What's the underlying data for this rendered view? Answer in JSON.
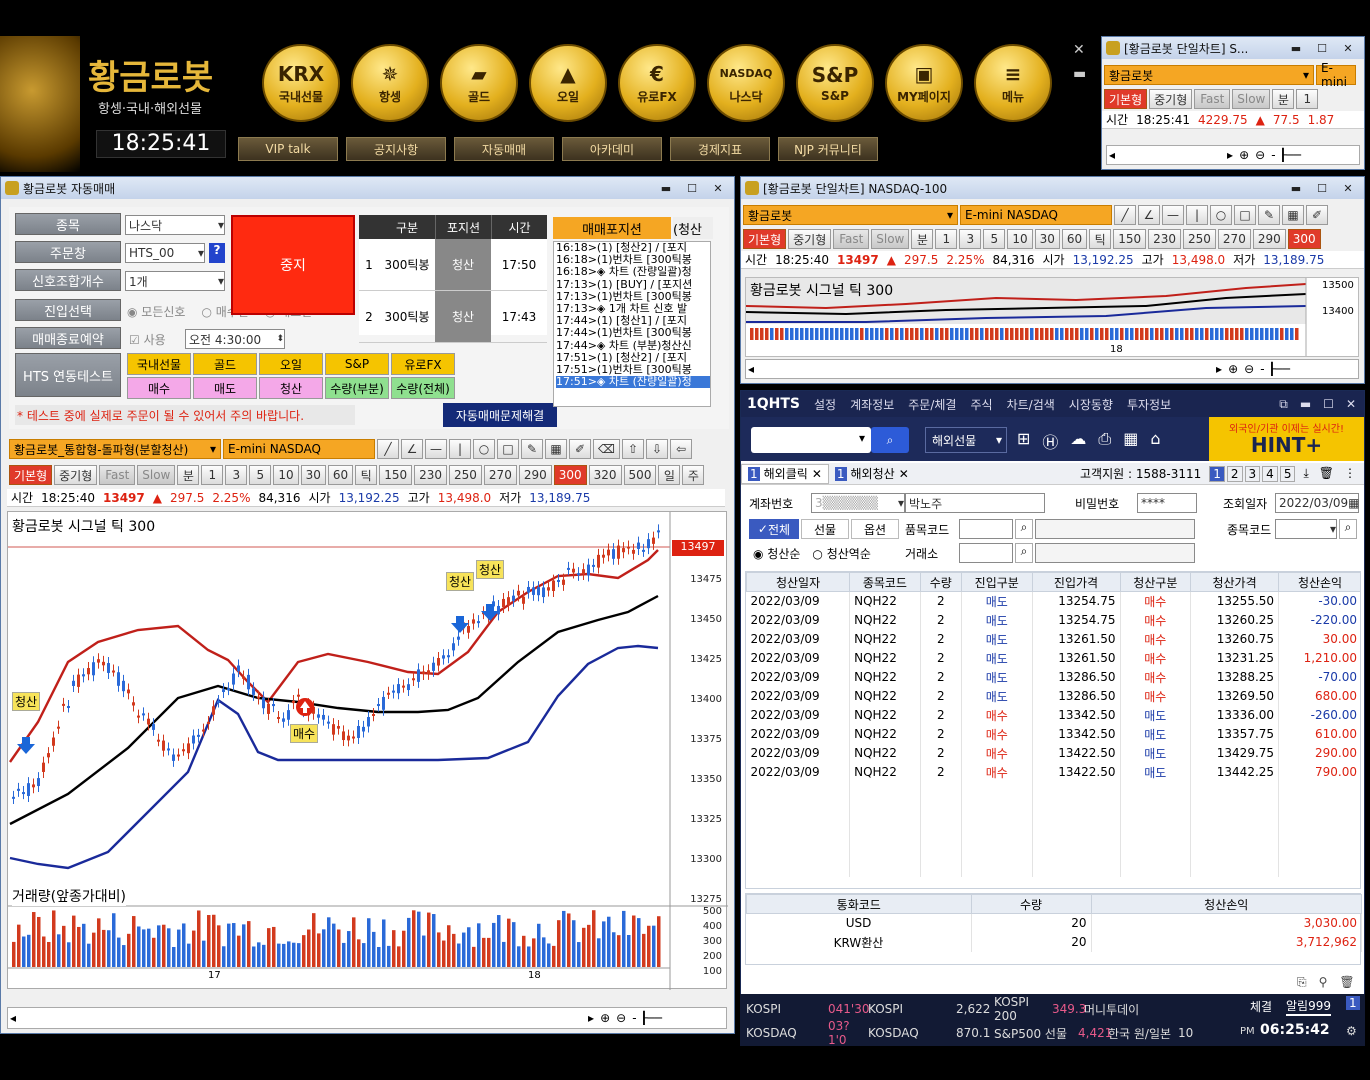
{
  "banner": {
    "logo": "황금로봇",
    "tagline": "항셍·국내·해외선물",
    "clock": "18:25:41",
    "buttons": [
      {
        "glyph": "KRX",
        "label": "국내선물"
      },
      {
        "glyph": "✵",
        "label": "항셍"
      },
      {
        "glyph": "▰",
        "label": "골드"
      },
      {
        "glyph": "▲",
        "label": "오일"
      },
      {
        "glyph": "€",
        "label": "유로FX"
      },
      {
        "glyph": "NASDAQ",
        "label": "나스닥"
      },
      {
        "glyph": "S&P",
        "label": "S&P"
      },
      {
        "glyph": "▣",
        "label": "MY페이지"
      },
      {
        "glyph": "≡",
        "label": "메뉴"
      }
    ],
    "links": [
      "VIP talk",
      "공지사항",
      "자동매매",
      "아카데미",
      "경제지표",
      "NJP 커뮤니티"
    ]
  },
  "mini_chart": {
    "title": "[황금로봇 단일차트] S...",
    "robot": "황금로봇",
    "symbol": "E-mini",
    "buttons": [
      "기본형",
      "중기형",
      "Fast",
      "Slow",
      "분",
      "1"
    ],
    "quote": {
      "label": "시간",
      "time": "18:25:41",
      "price": "4229.75",
      "arrow": "▲",
      "change": "77.5",
      "pct": "1.87"
    }
  },
  "nasdaq_chart": {
    "title": "[황금로봇 단일차트] NASDAQ-100",
    "robot": "황금로봇",
    "symbol": "E-mini NASDAQ",
    "buttons": [
      "기본형",
      "중기형",
      "Fast",
      "Slow",
      "분",
      "1",
      "3",
      "5",
      "10",
      "30",
      "60",
      "틱",
      "150",
      "230",
      "250",
      "270",
      "290",
      "300"
    ],
    "quote": {
      "label": "시간",
      "time": "18:25:40",
      "price": "13497",
      "arrow": "▲",
      "change": "297.5",
      "pct": "2.25%",
      "volume": "84,316",
      "open_l": "시가",
      "open": "13,192.25",
      "high_l": "고가",
      "high": "13,498.0",
      "low_l": "저가",
      "low": "13,189.75"
    },
    "signal": "황금로봇 시그널 틱 300",
    "yaxis": [
      "13500",
      "13400"
    ],
    "xlabel": "18"
  },
  "auto": {
    "title": "황금로봇 자동매매",
    "labels": {
      "symbol": "종목",
      "order": "주문창",
      "signal": "신호조합개수",
      "entry": "진입선택",
      "reserve": "매매종료예약",
      "hts": "HTS 연동테스트"
    },
    "symbol": "나스닥",
    "order": "HTS_00",
    "signal": "1개",
    "entry_opts": [
      "모든신호",
      "매수만",
      "매도만"
    ],
    "use": "사용",
    "reserve_time": "오전  4:30:00",
    "stop": "중지",
    "pos_headers": [
      "구분",
      "포지션",
      "시간"
    ],
    "positions": [
      {
        "n": "1",
        "type": "300틱봉",
        "pos": "청산",
        "time": "17:50"
      },
      {
        "n": "2",
        "type": "300틱봉",
        "pos": "청산",
        "time": "17:43"
      }
    ],
    "trade_pos": "매매포지션",
    "trade_pos2": "(청산",
    "hts_row1": [
      "국내선물",
      "골드",
      "오일",
      "S&P",
      "유로FX"
    ],
    "hts_row2": [
      "매수",
      "매도",
      "청산",
      "수량(부분)",
      "수량(전체)"
    ],
    "warning": "* 테스트 중에 실제로 주문이 될 수 있어서 주의 바랍니다.",
    "fix": "자동매매문제해결",
    "log": [
      "16:18>(1) [청산2] / [포지",
      "16:18>(1)번차트 [300틱봉",
      "16:18>◈ 차트 (잔량일괄)청",
      "17:13>(1) [BUY] / [포지션",
      "17:13>(1)번차트 [300틱봉",
      "17:13>◈ 1개 차트 신호 발",
      "17:44>(1) [청산1] / [포지",
      "17:44>(1)번차트 [300틱봉",
      "17:44>◈ 차트 (부분)청산신",
      "17:51>(1) [청산2] / [포지",
      "17:51>(1)번차트 [300틱봉",
      "17:51>◈ 차트 (잔량일괄)청"
    ]
  },
  "main_chart": {
    "robot": "황금로봇_통합형-돌파형(분할청산)",
    "symbol": "E-mini NASDAQ",
    "buttons": [
      "기본형",
      "중기형",
      "Fast",
      "Slow",
      "분",
      "1",
      "3",
      "5",
      "10",
      "30",
      "60",
      "틱",
      "150",
      "230",
      "250",
      "270",
      "290",
      "300",
      "320",
      "500",
      "일",
      "주"
    ],
    "quote": {
      "label": "시간",
      "time": "18:25:40",
      "price": "13497",
      "arrow": "▲",
      "change": "297.5",
      "pct": "2.25%",
      "volume": "84,316",
      "open_l": "시가",
      "open": "13,192.25",
      "high_l": "고가",
      "high": "13,498.0",
      "low_l": "저가",
      "low": "13,189.75"
    },
    "signal": "황금로봇 시그널 틱 300",
    "last": "13497",
    "yaxis": [
      "13475",
      "13450",
      "13425",
      "13400",
      "13375",
      "13350",
      "13325",
      "13300",
      "13275"
    ],
    "vol_title": "거래량(앞종가대비)",
    "vol_axis": [
      "500",
      "400",
      "300",
      "200",
      "100"
    ],
    "xlabels": [
      "17",
      "18"
    ],
    "markers": {
      "sell1": "청산",
      "buy": "매수",
      "sell2": "청산",
      "sell3": "청산"
    }
  },
  "hts": {
    "logo": "1QHTS",
    "menu": [
      "설정",
      "계좌정보",
      "주문/체결",
      "주식",
      "차트/검색",
      "시장동향",
      "투자정보"
    ],
    "market": "해외선물",
    "ad1": "외국인/기관 이제는 실시간!",
    "ad2": "HINT+",
    "tabs": [
      "해외클릭",
      "해외청산"
    ],
    "support": "고객지원 : 1588-3111",
    "pages": [
      "1",
      "2",
      "3",
      "4",
      "5"
    ],
    "form": {
      "acct_l": "계좌번호",
      "name": "박노주",
      "pw_l": "비밀번호",
      "pw": "****",
      "date_l": "조회일자",
      "date": "2022/03/09",
      "all": "전체",
      "fut": "선물",
      "opt": "옵션",
      "item_l": "품목코드",
      "code_l": "종목코드",
      "ex_l": "거래소",
      "sort1": "청산순",
      "sort2": "청산역순"
    },
    "headers": [
      "청산일자",
      "종목코드",
      "수량",
      "진입구분",
      "진입가격",
      "청산구분",
      "청산가격",
      "청산손익"
    ],
    "rows": [
      [
        "2022/03/09",
        "NQH22",
        "2",
        "매도",
        "13254.75",
        "매수",
        "13255.50",
        "-30.00"
      ],
      [
        "2022/03/09",
        "NQH22",
        "2",
        "매도",
        "13254.75",
        "매수",
        "13260.25",
        "-220.00"
      ],
      [
        "2022/03/09",
        "NQH22",
        "2",
        "매도",
        "13261.50",
        "매수",
        "13260.75",
        "30.00"
      ],
      [
        "2022/03/09",
        "NQH22",
        "2",
        "매도",
        "13261.50",
        "매수",
        "13231.25",
        "1,210.00"
      ],
      [
        "2022/03/09",
        "NQH22",
        "2",
        "매도",
        "13286.50",
        "매수",
        "13288.25",
        "-70.00"
      ],
      [
        "2022/03/09",
        "NQH22",
        "2",
        "매도",
        "13286.50",
        "매수",
        "13269.50",
        "680.00"
      ],
      [
        "2022/03/09",
        "NQH22",
        "2",
        "매수",
        "13342.50",
        "매도",
        "13336.00",
        "-260.00"
      ],
      [
        "2022/03/09",
        "NQH22",
        "2",
        "매수",
        "13342.50",
        "매도",
        "13357.75",
        "610.00"
      ],
      [
        "2022/03/09",
        "NQH22",
        "2",
        "매수",
        "13422.50",
        "매도",
        "13429.75",
        "290.00"
      ],
      [
        "2022/03/09",
        "NQH22",
        "2",
        "매수",
        "13422.50",
        "매도",
        "13442.25",
        "790.00"
      ]
    ],
    "sum_headers": [
      "통화코드",
      "수량",
      "청산손익"
    ],
    "sums": [
      [
        "USD",
        "20",
        "3,030.00"
      ],
      [
        "KRW환산",
        "20",
        "3,712,962"
      ]
    ],
    "ticker": {
      "r1": [
        "KOSPI",
        "041'30",
        "KOSPI",
        "2,622",
        "KOSPI 200",
        "349.3",
        "머니투데이"
      ],
      "r2": [
        "KOSDAQ",
        "03?1'0",
        "KOSDAQ",
        "870.1",
        "S&P500 선물",
        "4,421",
        "한국 원/일본",
        "10"
      ],
      "chegyeol": "체결",
      "alarm": "알림999",
      "pm": "PM",
      "clock": "06:25:42"
    }
  },
  "colors": {
    "upper_band": "#c0201a",
    "lower_band": "#1a2a9a",
    "mid": "#000000",
    "up_candle": "#d23a1e",
    "down_candle": "#2a6ad8"
  }
}
